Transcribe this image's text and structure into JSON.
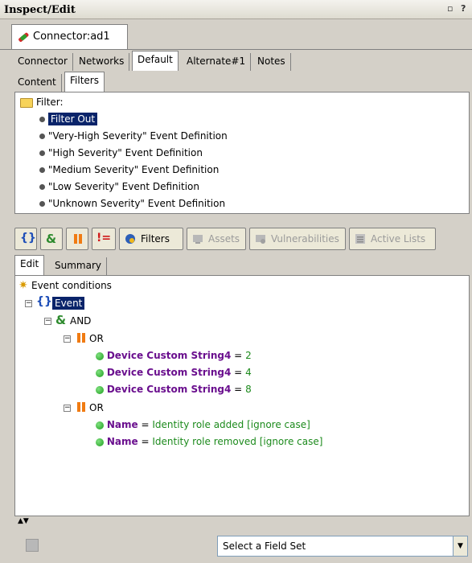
{
  "window": {
    "title": "Inspect/Edit",
    "controls": [
      "▫",
      "?"
    ]
  },
  "doc_tab": {
    "label": "Connector:ad1",
    "icon": "connector-icon"
  },
  "main_tabs": [
    {
      "label": "Connector"
    },
    {
      "label": "Networks"
    },
    {
      "label": "Default",
      "active": true
    },
    {
      "label": "Alternate#1"
    },
    {
      "label": "Notes"
    }
  ],
  "sub_tabs": [
    {
      "label": "Content"
    },
    {
      "label": "Filters",
      "active": true
    }
  ],
  "filter_tree": {
    "root": "Filter:",
    "items": [
      {
        "label": "Filter Out",
        "selected": true
      },
      {
        "label": "\"Very-High Severity\" Event Definition"
      },
      {
        "label": "\"High Severity\" Event Definition"
      },
      {
        "label": "\"Medium Severity\" Event Definition"
      },
      {
        "label": "\"Low Severity\" Event Definition"
      },
      {
        "label": "\"Unknown Severity\" Event Definition"
      }
    ]
  },
  "toolbar": {
    "buttons": [
      {
        "icon": "curly-braces-icon"
      },
      {
        "icon": "and-icon"
      },
      {
        "icon": "or-icon"
      },
      {
        "icon": "not-icon"
      },
      {
        "label": "Filters",
        "icon": "filters-icon"
      },
      {
        "label": "Assets",
        "icon": "assets-icon",
        "disabled": true
      },
      {
        "label": "Vulnerabilities",
        "icon": "vulnerabilities-icon",
        "disabled": true
      },
      {
        "label": "Active Lists",
        "icon": "active-lists-icon",
        "disabled": true
      }
    ]
  },
  "edit_tabs": [
    {
      "label": "Edit",
      "active": true
    },
    {
      "label": "Summary"
    }
  ],
  "conditions": {
    "root": "Event conditions",
    "event_label": "Event",
    "and_label": "AND",
    "or1_label": "OR",
    "or1_items": [
      {
        "field": "Device Custom String4",
        "op": "=",
        "value": "2"
      },
      {
        "field": "Device Custom String4",
        "op": "=",
        "value": "4"
      },
      {
        "field": "Device Custom String4",
        "op": "=",
        "value": "8"
      }
    ],
    "or2_label": "OR",
    "or2_items": [
      {
        "field": "Name",
        "op": "=",
        "value": "Identity role added [ignore case]"
      },
      {
        "field": "Name",
        "op": "=",
        "value": "Identity role removed [ignore case]"
      }
    ]
  },
  "field_set": {
    "value": "Select a Field Set"
  }
}
